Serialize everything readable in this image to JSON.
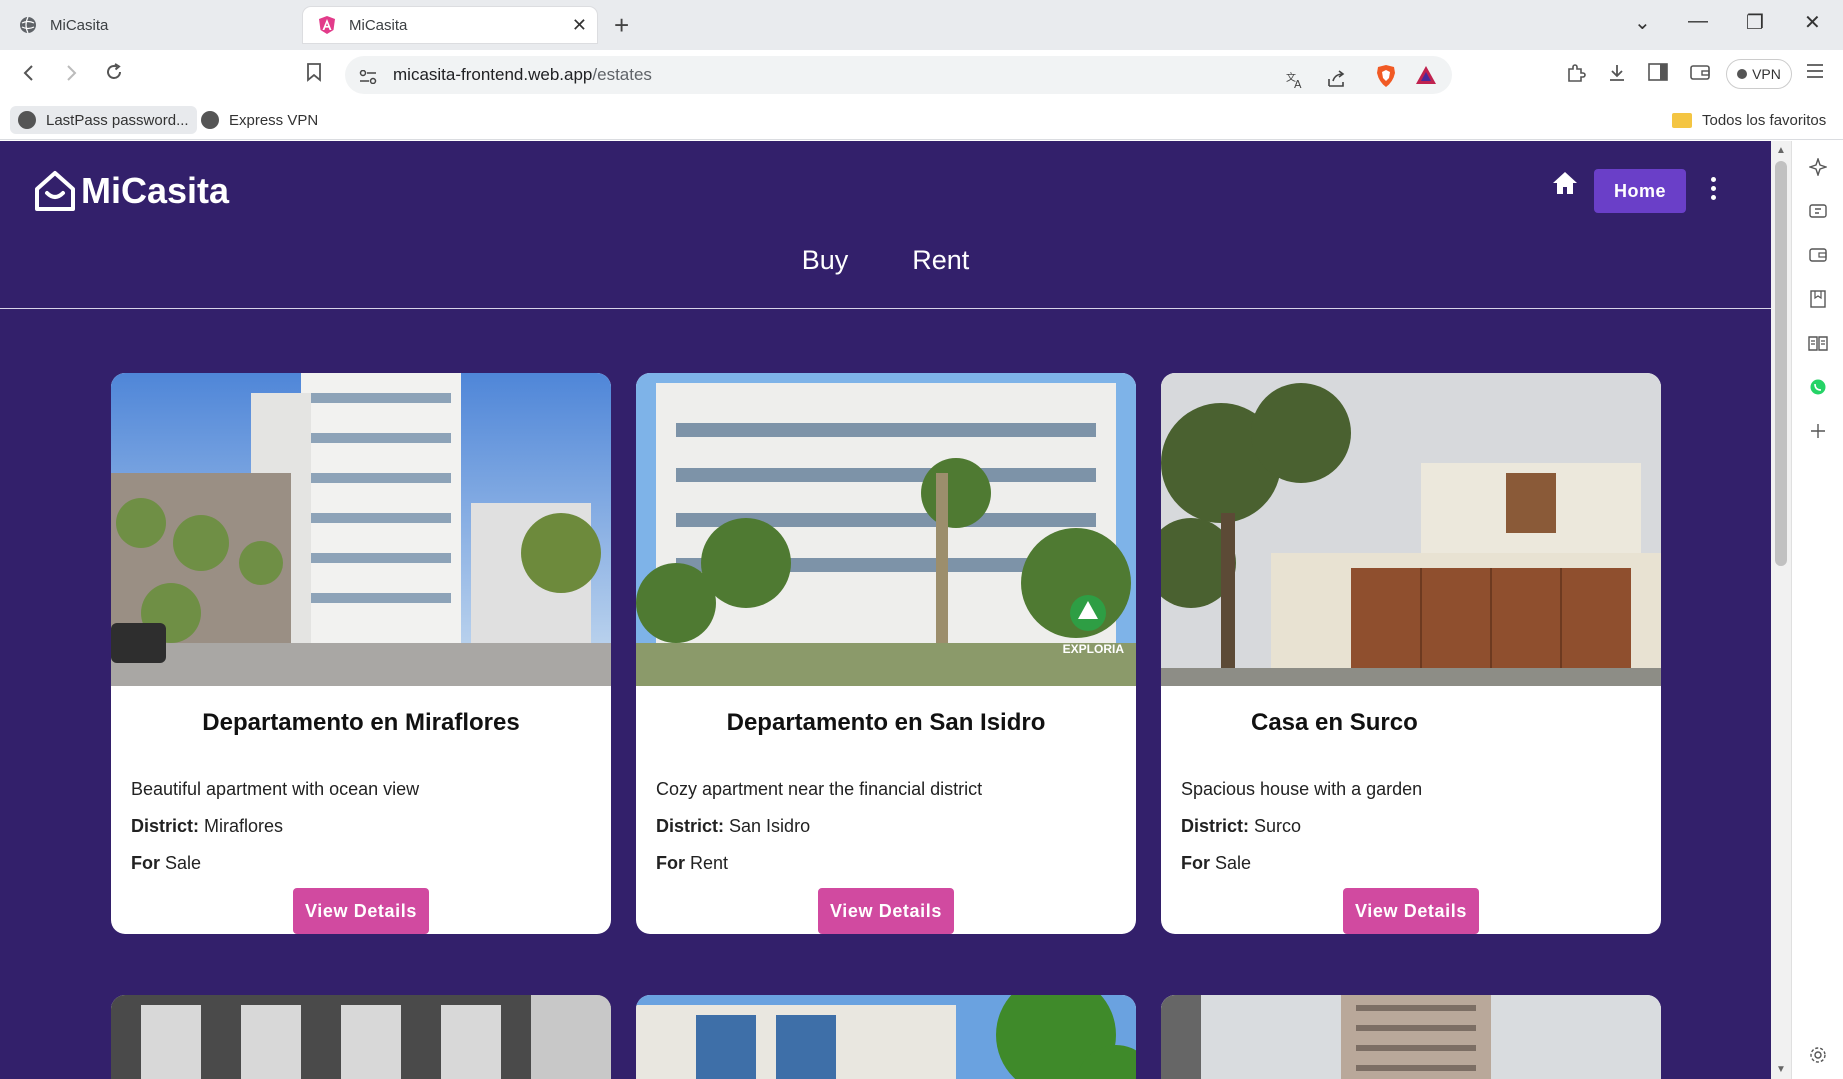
{
  "browser": {
    "tabs": [
      {
        "label": "MiCasita",
        "active": false
      },
      {
        "label": "MiCasita",
        "active": true
      }
    ],
    "close_glyph": "✕",
    "new_tab_glyph": "+",
    "window_controls": {
      "dropdown": "⌄",
      "minimize": "—",
      "restore": "❐",
      "close": "✕"
    },
    "address": {
      "host": "micasita-frontend.web.app",
      "path": "/estates"
    },
    "vpn_label": "VPN",
    "bookmarks": [
      {
        "label": "LastPass password..."
      },
      {
        "label": "Express VPN"
      }
    ],
    "all_bookmarks_label": "Todos los favoritos"
  },
  "site": {
    "brand": "MiCasita",
    "home_button": "Home",
    "nav": [
      {
        "label": "Buy"
      },
      {
        "label": "Rent"
      }
    ],
    "district_label": "District:",
    "for_label": "For",
    "details_button": "View Details",
    "accent": "#33206b",
    "button_color": "#6a3fc8",
    "details_color": "#d14aa0"
  },
  "estates": [
    {
      "title": "Departamento en Miraflores",
      "description": "Beautiful apartment with ocean view",
      "district": "Miraflores",
      "for": "Sale"
    },
    {
      "title": "Departamento en San Isidro",
      "description": "Cozy apartment near the financial district",
      "district": "San Isidro",
      "for": "Rent",
      "watermark": "EXPLORIA"
    },
    {
      "title": "Casa en Surco",
      "description": "Spacious house with a garden",
      "district": "Surco",
      "for": "Sale"
    }
  ]
}
